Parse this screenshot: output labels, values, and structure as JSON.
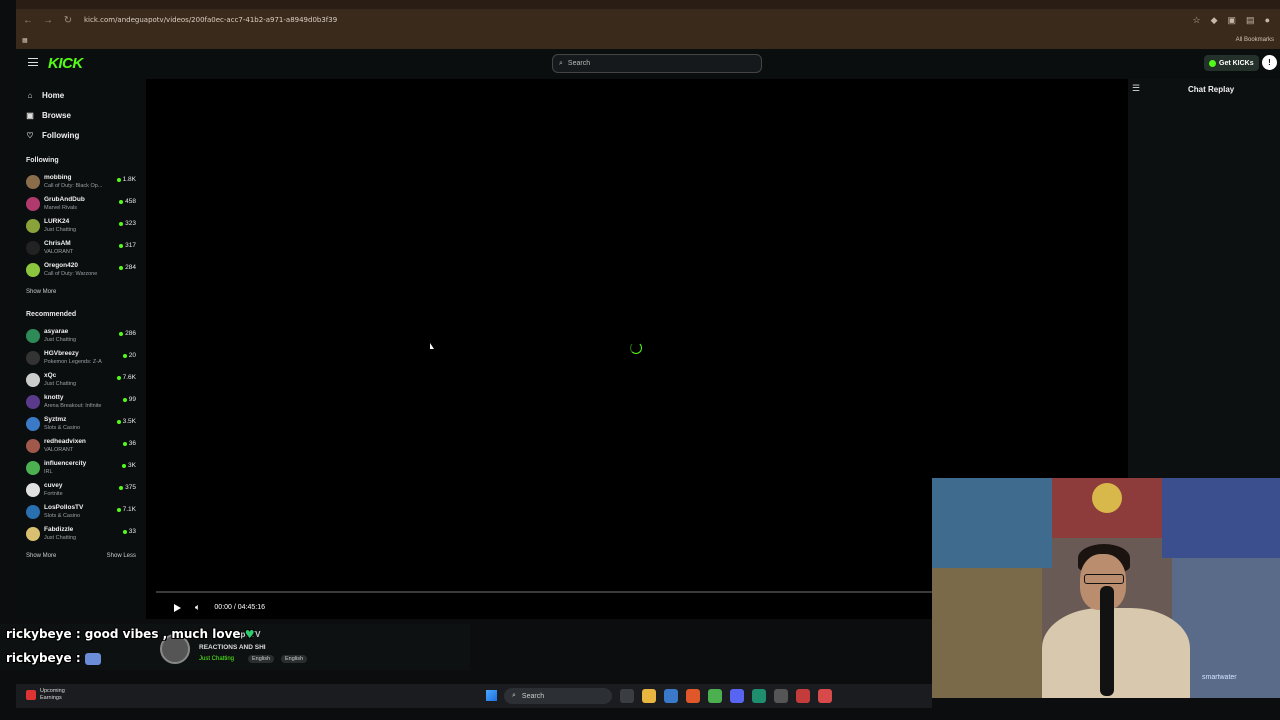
{
  "browser": {
    "url": "kick.com/andeguapotv/videos/200fa0ec-acc7-41b2-a971-a8949d0b3f39",
    "bookmarks_label": "All Bookmarks"
  },
  "header": {
    "logo": "KICK",
    "search_placeholder": "Search",
    "get_kicks_label": "Get KICKs"
  },
  "sidebar": {
    "nav": [
      {
        "label": "Home",
        "icon": "home-icon"
      },
      {
        "label": "Browse",
        "icon": "browse-icon"
      },
      {
        "label": "Following",
        "icon": "heart-icon"
      }
    ],
    "following_title": "Following",
    "following": [
      {
        "name": "mobbing",
        "game": "Call of Duty: Black Op...",
        "count": "1.8K",
        "color": "#8a6d4a"
      },
      {
        "name": "GrubAndDub",
        "game": "Marvel Rivals",
        "count": "458",
        "color": "#b03a6e"
      },
      {
        "name": "LURK24",
        "game": "Just Chatting",
        "count": "323",
        "color": "#8aa23a"
      },
      {
        "name": "ChrisAM",
        "game": "VALORANT",
        "count": "317",
        "color": "#222222"
      },
      {
        "name": "Oregon420",
        "game": "Call of Duty: Warzone",
        "count": "284",
        "color": "#8cc63f"
      }
    ],
    "show_more_1": "Show More",
    "recommended_title": "Recommended",
    "recommended": [
      {
        "name": "asyarae",
        "game": "Just Chatting",
        "count": "286",
        "color": "#2e8b57"
      },
      {
        "name": "HGVbreezy",
        "game": "Pokemon Legends: Z-A",
        "count": "20",
        "color": "#333333"
      },
      {
        "name": "xQc",
        "game": "Just Chatting",
        "count": "7.6K",
        "color": "#cccccc"
      },
      {
        "name": "knotty",
        "game": "Arena Breakout: Infinite",
        "count": "99",
        "color": "#5a3a8a"
      },
      {
        "name": "Syztmz",
        "game": "Slots & Casino",
        "count": "3.5K",
        "color": "#3a7ac6"
      },
      {
        "name": "redheadvixen",
        "game": "VALORANT",
        "count": "36",
        "color": "#a0584a"
      },
      {
        "name": "influencercity",
        "game": "IRL",
        "count": "3K",
        "color": "#4caf50"
      },
      {
        "name": "cuvey",
        "game": "Fortnite",
        "count": "375",
        "color": "#e0e0e0"
      },
      {
        "name": "LosPollosTV",
        "game": "Slots & Casino",
        "count": "7.1K",
        "color": "#2a6fb0"
      },
      {
        "name": "Fabdizzle",
        "game": "Just Chatting",
        "count": "33",
        "color": "#d8c070"
      }
    ],
    "show_more_2": "Show More",
    "show_less": "Show Less"
  },
  "player": {
    "time": "00:00 / 04:45:16",
    "progress": 0
  },
  "chat": {
    "title": "Chat Replay"
  },
  "stream_info": {
    "streamer_partial": "apoTV",
    "title": "REACTIONS AND SHI",
    "category": "Just Chatting",
    "tags": [
      "English",
      "English"
    ]
  },
  "overlay_chat": [
    {
      "user": "rickybeye",
      "text": ": good vibes , much love"
    },
    {
      "user": "rickybeye",
      "text": ":"
    }
  ],
  "webcam": {
    "watermark": "smartwater"
  },
  "taskbar": {
    "upcoming_title": "Upcoming",
    "upcoming_sub": "Earnings",
    "search_label": "Search"
  }
}
